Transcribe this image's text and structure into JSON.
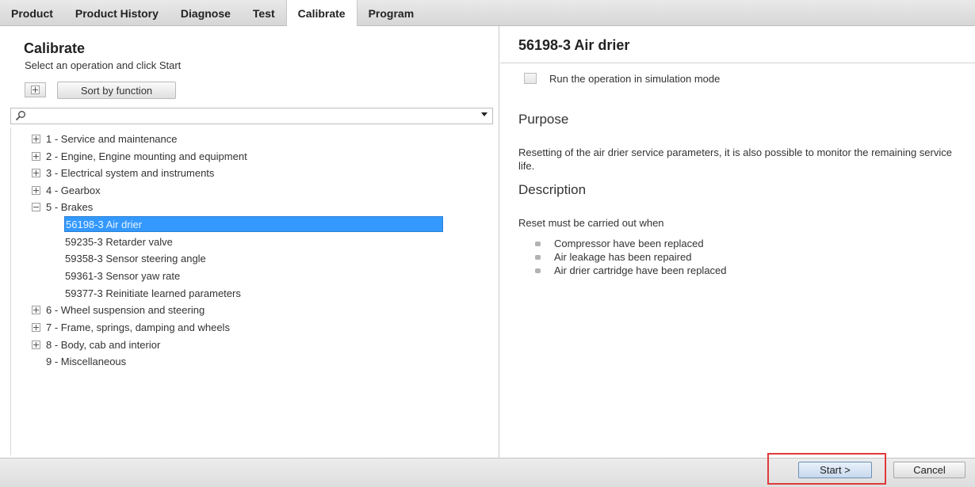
{
  "tabs": [
    {
      "label": "Product"
    },
    {
      "label": "Product History"
    },
    {
      "label": "Diagnose"
    },
    {
      "label": "Test"
    },
    {
      "label": "Calibrate",
      "active": true
    },
    {
      "label": "Program"
    }
  ],
  "left": {
    "title": "Calibrate",
    "subtitle": "Select an operation and click Start",
    "sort_button": "Sort by function",
    "search_placeholder": "",
    "tree": [
      {
        "label": "1 - Service and maintenance",
        "state": "collapsed"
      },
      {
        "label": "2 - Engine, Engine mounting and equipment",
        "state": "collapsed"
      },
      {
        "label": "3 - Electrical system and instruments",
        "state": "collapsed"
      },
      {
        "label": "4 - Gearbox",
        "state": "collapsed"
      },
      {
        "label": "5 - Brakes",
        "state": "expanded",
        "children": [
          {
            "label": "56198-3 Air drier",
            "selected": true
          },
          {
            "label": "59235-3 Retarder valve"
          },
          {
            "label": "59358-3 Sensor steering angle"
          },
          {
            "label": "59361-3 Sensor yaw rate"
          },
          {
            "label": "59377-3 Reinitiate learned parameters"
          }
        ]
      },
      {
        "label": "6 - Wheel suspension and steering",
        "state": "collapsed"
      },
      {
        "label": "7 - Frame, springs, damping and wheels",
        "state": "collapsed"
      },
      {
        "label": "8 - Body, cab and interior",
        "state": "collapsed"
      },
      {
        "label": "9 - Miscellaneous",
        "state": "none"
      }
    ]
  },
  "right": {
    "title": "56198-3 Air drier",
    "simulation_label": "Run the operation in simulation mode",
    "purpose_heading": "Purpose",
    "purpose_text": "Resetting of the air drier service parameters, it is also possible to monitor the remaining service life.",
    "description_heading": "Description",
    "description_intro": "Reset must be carried out when",
    "bullets": [
      "Compressor have been replaced",
      "Air leakage has been repaired",
      "Air drier cartridge have been replaced"
    ]
  },
  "bottom": {
    "start_label": "Start >",
    "cancel_label": "Cancel"
  },
  "colors": {
    "selection": "#3399ff",
    "highlight_border": "#e03a3a"
  },
  "icons": {
    "search": "magnifier-icon",
    "dropdown": "chevron-down-icon",
    "expand_all": "plus-box-icon"
  }
}
